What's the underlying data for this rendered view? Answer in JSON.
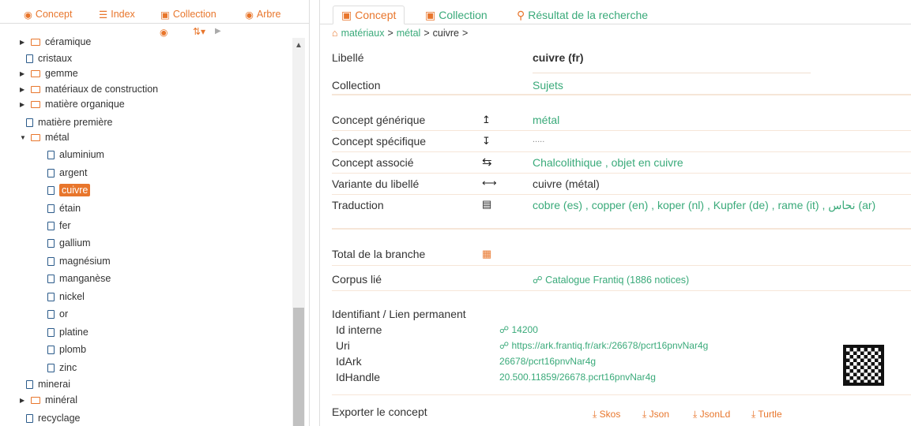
{
  "left_tabs": [
    "Concept",
    "Index",
    "Collection",
    "Arbre"
  ],
  "tree": [
    {
      "label": "céramique",
      "lvl": 0,
      "type": "folder",
      "exp": false
    },
    {
      "label": "cristaux",
      "lvl": 0,
      "type": "doc"
    },
    {
      "label": "gemme",
      "lvl": 0,
      "type": "folder",
      "exp": false
    },
    {
      "label": "matériaux de construction",
      "lvl": 0,
      "type": "folder",
      "exp": false
    },
    {
      "label": "matière organique",
      "lvl": 0,
      "type": "folder",
      "exp": false
    },
    {
      "label": "matière première",
      "lvl": 0,
      "type": "doc"
    },
    {
      "label": "métal",
      "lvl": 0,
      "type": "folder",
      "exp": true
    },
    {
      "label": "aluminium",
      "lvl": 1,
      "type": "doc"
    },
    {
      "label": "argent",
      "lvl": 1,
      "type": "doc"
    },
    {
      "label": "cuivre",
      "lvl": 1,
      "type": "doc",
      "sel": true
    },
    {
      "label": "étain",
      "lvl": 1,
      "type": "doc"
    },
    {
      "label": "fer",
      "lvl": 1,
      "type": "doc"
    },
    {
      "label": "gallium",
      "lvl": 1,
      "type": "doc"
    },
    {
      "label": "magnésium",
      "lvl": 1,
      "type": "doc"
    },
    {
      "label": "manganèse",
      "lvl": 1,
      "type": "doc"
    },
    {
      "label": "nickel",
      "lvl": 1,
      "type": "doc"
    },
    {
      "label": "or",
      "lvl": 1,
      "type": "doc"
    },
    {
      "label": "platine",
      "lvl": 1,
      "type": "doc"
    },
    {
      "label": "plomb",
      "lvl": 1,
      "type": "doc"
    },
    {
      "label": "zinc",
      "lvl": 1,
      "type": "doc"
    },
    {
      "label": "minerai",
      "lvl": 0,
      "type": "doc"
    },
    {
      "label": "minéral",
      "lvl": 0,
      "type": "folder",
      "exp": false
    },
    {
      "label": "recyclage",
      "lvl": 0,
      "type": "doc"
    }
  ],
  "right_tabs": [
    "Concept",
    "Collection",
    "Résultat de la recherche"
  ],
  "breadcrumb": {
    "a": "matériaux",
    "b": "métal",
    "c": "cuivre"
  },
  "f": {
    "libelle_l": "Libellé",
    "libelle_v": "cuivre (fr)",
    "coll_l": "Collection",
    "coll_v": "Sujets",
    "gen_l": "Concept générique",
    "gen_v": "métal",
    "spec_l": "Concept spécifique",
    "spec_v": ".....",
    "assoc_l": "Concept associé",
    "assoc_v": "Chalcolithique , objet en cuivre",
    "var_l": "Variante du libellé",
    "var_v": "cuivre (métal)",
    "trad_l": "Traduction",
    "trad_v": "cobre (es) , copper (en) , koper (nl) , Kupfer (de) , rame (it) , نحاس (ar)",
    "tot_l": "Total de la branche",
    "corp_l": "Corpus lié",
    "corp_v": "Catalogue Frantiq (1886 notices)",
    "id_l": "Identifiant / Lien permanent",
    "idi_l": "Id interne",
    "idi_v": "14200",
    "uri_l": "Uri",
    "uri_v": "https://ark.frantiq.fr/ark:/26678/pcrt16pnvNar4g",
    "ark_l": "IdArk",
    "ark_v": "26678/pcrt16pnvNar4g",
    "hdl_l": "IdHandle",
    "hdl_v": "20.500.11859/26678.pcrt16pnvNar4g",
    "exp_l": "Exporter le concept"
  },
  "exports": [
    "Skos",
    "Json",
    "JsonLd",
    "Turtle"
  ]
}
